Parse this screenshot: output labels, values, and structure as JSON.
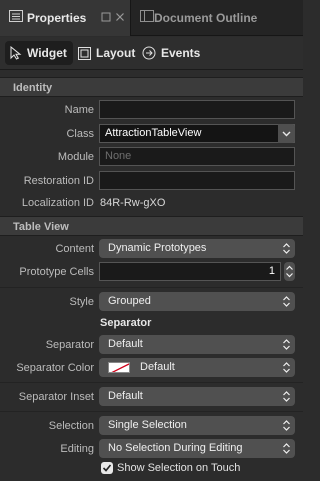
{
  "tabs": {
    "properties": "Properties",
    "document_outline": "Document Outline"
  },
  "segments": {
    "widget": "Widget",
    "layout": "Layout",
    "events": "Events"
  },
  "identity": {
    "header": "Identity",
    "name_label": "Name",
    "name_value": "",
    "class_label": "Class",
    "class_value": "AttractionTableView",
    "module_label": "Module",
    "module_placeholder": "None",
    "restoration_label": "Restoration ID",
    "restoration_value": "",
    "localization_label": "Localization ID",
    "localization_value": "84R-Rw-gXO"
  },
  "table_view": {
    "header": "Table View",
    "content_label": "Content",
    "content_value": "Dynamic Prototypes",
    "prototype_label": "Prototype Cells",
    "prototype_value": "1",
    "style_label": "Style",
    "style_value": "Grouped",
    "separator_header": "Separator",
    "separator_label": "Separator",
    "separator_value": "Default",
    "separator_color_label": "Separator Color",
    "separator_color_value": "Default",
    "separator_inset_label": "Separator Inset",
    "separator_inset_value": "Default",
    "selection_label": "Selection",
    "selection_value": "Single Selection",
    "editing_label": "Editing",
    "editing_value": "No Selection During Editing",
    "show_selection_label": "Show Selection on Touch",
    "show_selection_checked": true
  }
}
